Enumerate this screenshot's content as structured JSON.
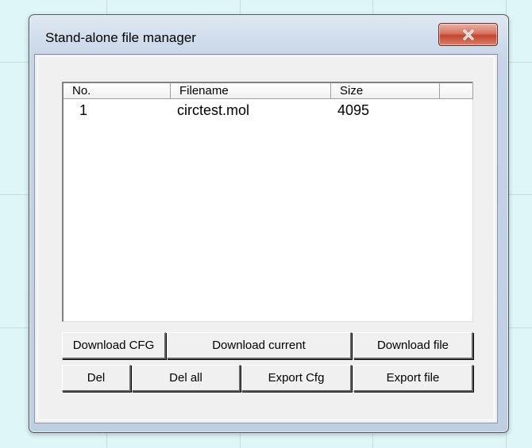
{
  "window": {
    "title": "Stand-alone file manager"
  },
  "list": {
    "columns": [
      "No.",
      "Filename",
      "Size"
    ],
    "rows": [
      {
        "no": "1",
        "filename": "circtest.mol",
        "size": "4095"
      }
    ]
  },
  "buttons": {
    "download_cfg": "Download CFG",
    "download_current": "Download current",
    "download_file": "Download file",
    "del": "Del",
    "del_all": "Del all",
    "export_cfg": "Export Cfg",
    "export_file": "Export file"
  },
  "colors": {
    "desktop": "#dff6f6",
    "close_button": "#c4462f",
    "client_bg": "#f0f0f0"
  },
  "icons": {
    "close": "close-icon"
  }
}
